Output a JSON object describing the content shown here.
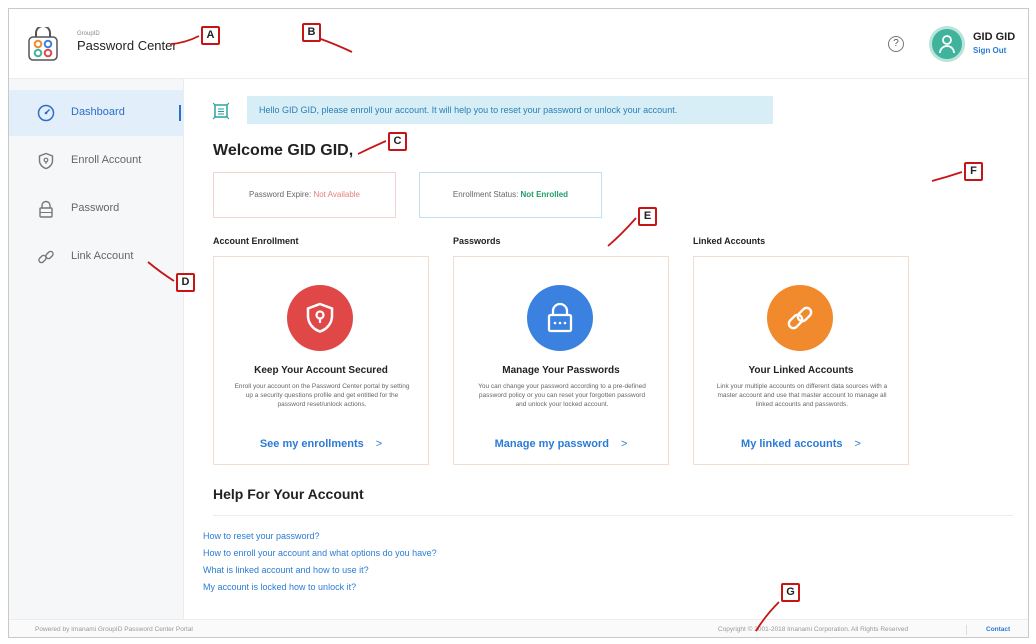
{
  "header": {
    "brand_small": "GroupID",
    "brand_name": "Password Center",
    "help_icon_glyph": "?",
    "user_name": "GID GID",
    "sign_out": "Sign Out"
  },
  "sidebar": {
    "items": [
      {
        "label": "Dashboard",
        "icon": "dashboard-icon",
        "active": true
      },
      {
        "label": "Enroll Account",
        "icon": "shield-icon",
        "active": false
      },
      {
        "label": "Password",
        "icon": "lock-icon",
        "active": false
      },
      {
        "label": "Link Account",
        "icon": "link-icon",
        "active": false
      }
    ]
  },
  "main": {
    "notice": "Hello GID GID, please enroll your account. It will help you to reset your password or unlock your account.",
    "welcome": "Welcome GID GID,",
    "password_expire_label": "Password Expire: ",
    "password_expire_value": "Not Available",
    "enrollment_status_label": "Enrollment Status: ",
    "enrollment_status_value": "Not Enrolled",
    "columns": [
      {
        "heading": "Account Enrollment",
        "title": "Keep Your Account Secured",
        "desc": "Enroll your account on the Password Center portal by setting up a security questions profile and get entitled for the password reset/unlock actions.",
        "link": "See my enrollments",
        "color": "#e04848"
      },
      {
        "heading": "Passwords",
        "title": "Manage Your Passwords",
        "desc": "You can change your password according to a pre-defined password policy or you can reset your forgotten password and unlock your locked account.",
        "link": "Manage my password",
        "color": "#3b82e0"
      },
      {
        "heading": "Linked Accounts",
        "title": "Your Linked Accounts",
        "desc": "Link your multiple accounts on different data sources with a master account and use that master account to manage all linked accounts and passwords.",
        "link": "My linked accounts",
        "color": "#f08a2c"
      }
    ],
    "link_arrow": ">",
    "help_title": "Help For Your Account",
    "help_links": [
      "How to reset your password?",
      "How to enroll your account and what options do you have?",
      "What is linked account and how to use it?",
      "My account is locked how to unlock it?"
    ]
  },
  "footer": {
    "powered_by": "Powered by Imanami GroupID Password Center Portal",
    "copyright": "Copyright © 2001-2018 Imanami Corporation. All Rights Reserved",
    "contact": "Contact"
  },
  "callouts": [
    "A",
    "B",
    "C",
    "D",
    "E",
    "F",
    "G"
  ]
}
